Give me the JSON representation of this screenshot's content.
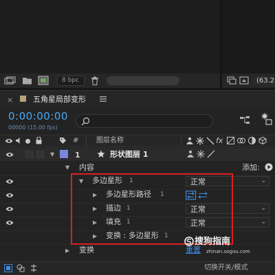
{
  "project_toolbar": {
    "bpc_label": "8 bpc",
    "readout": "(63.2"
  },
  "timeline": {
    "comp_name": "五角星局部变形",
    "timecode": "0:00:00:00",
    "fps_label": "00000 (15.00 fps)",
    "search_placeholder": "",
    "columns": {
      "number": "#",
      "layer_name": "图层名称"
    },
    "layer": {
      "index": "1",
      "name": "形状图层 1",
      "label_color": "#7b85e0"
    },
    "contents_label": "内容",
    "add_label": "添加:",
    "properties": [
      {
        "name": "多边星形",
        "index": "1",
        "mode": "正常",
        "kind": "group"
      },
      {
        "name": "多边星形路径",
        "index": "1",
        "kind": "path"
      },
      {
        "name": "描边",
        "index": "1",
        "mode": "正常",
        "kind": "stroke"
      },
      {
        "name": "填充",
        "index": "1",
        "mode": "正常",
        "kind": "fill"
      },
      {
        "name": "变换 : 多边星形",
        "index": "1",
        "kind": "transform"
      }
    ],
    "transform_label": "变换",
    "reset_label": "重置",
    "bottom_label": "切换开关/模式"
  },
  "watermark": {
    "text": "搜狗指南",
    "url": "zhinan.sogou.com"
  },
  "colors": {
    "highlight_border": "#e01e1e",
    "timecode": "#4aa8f4",
    "link": "#3d8be0"
  }
}
